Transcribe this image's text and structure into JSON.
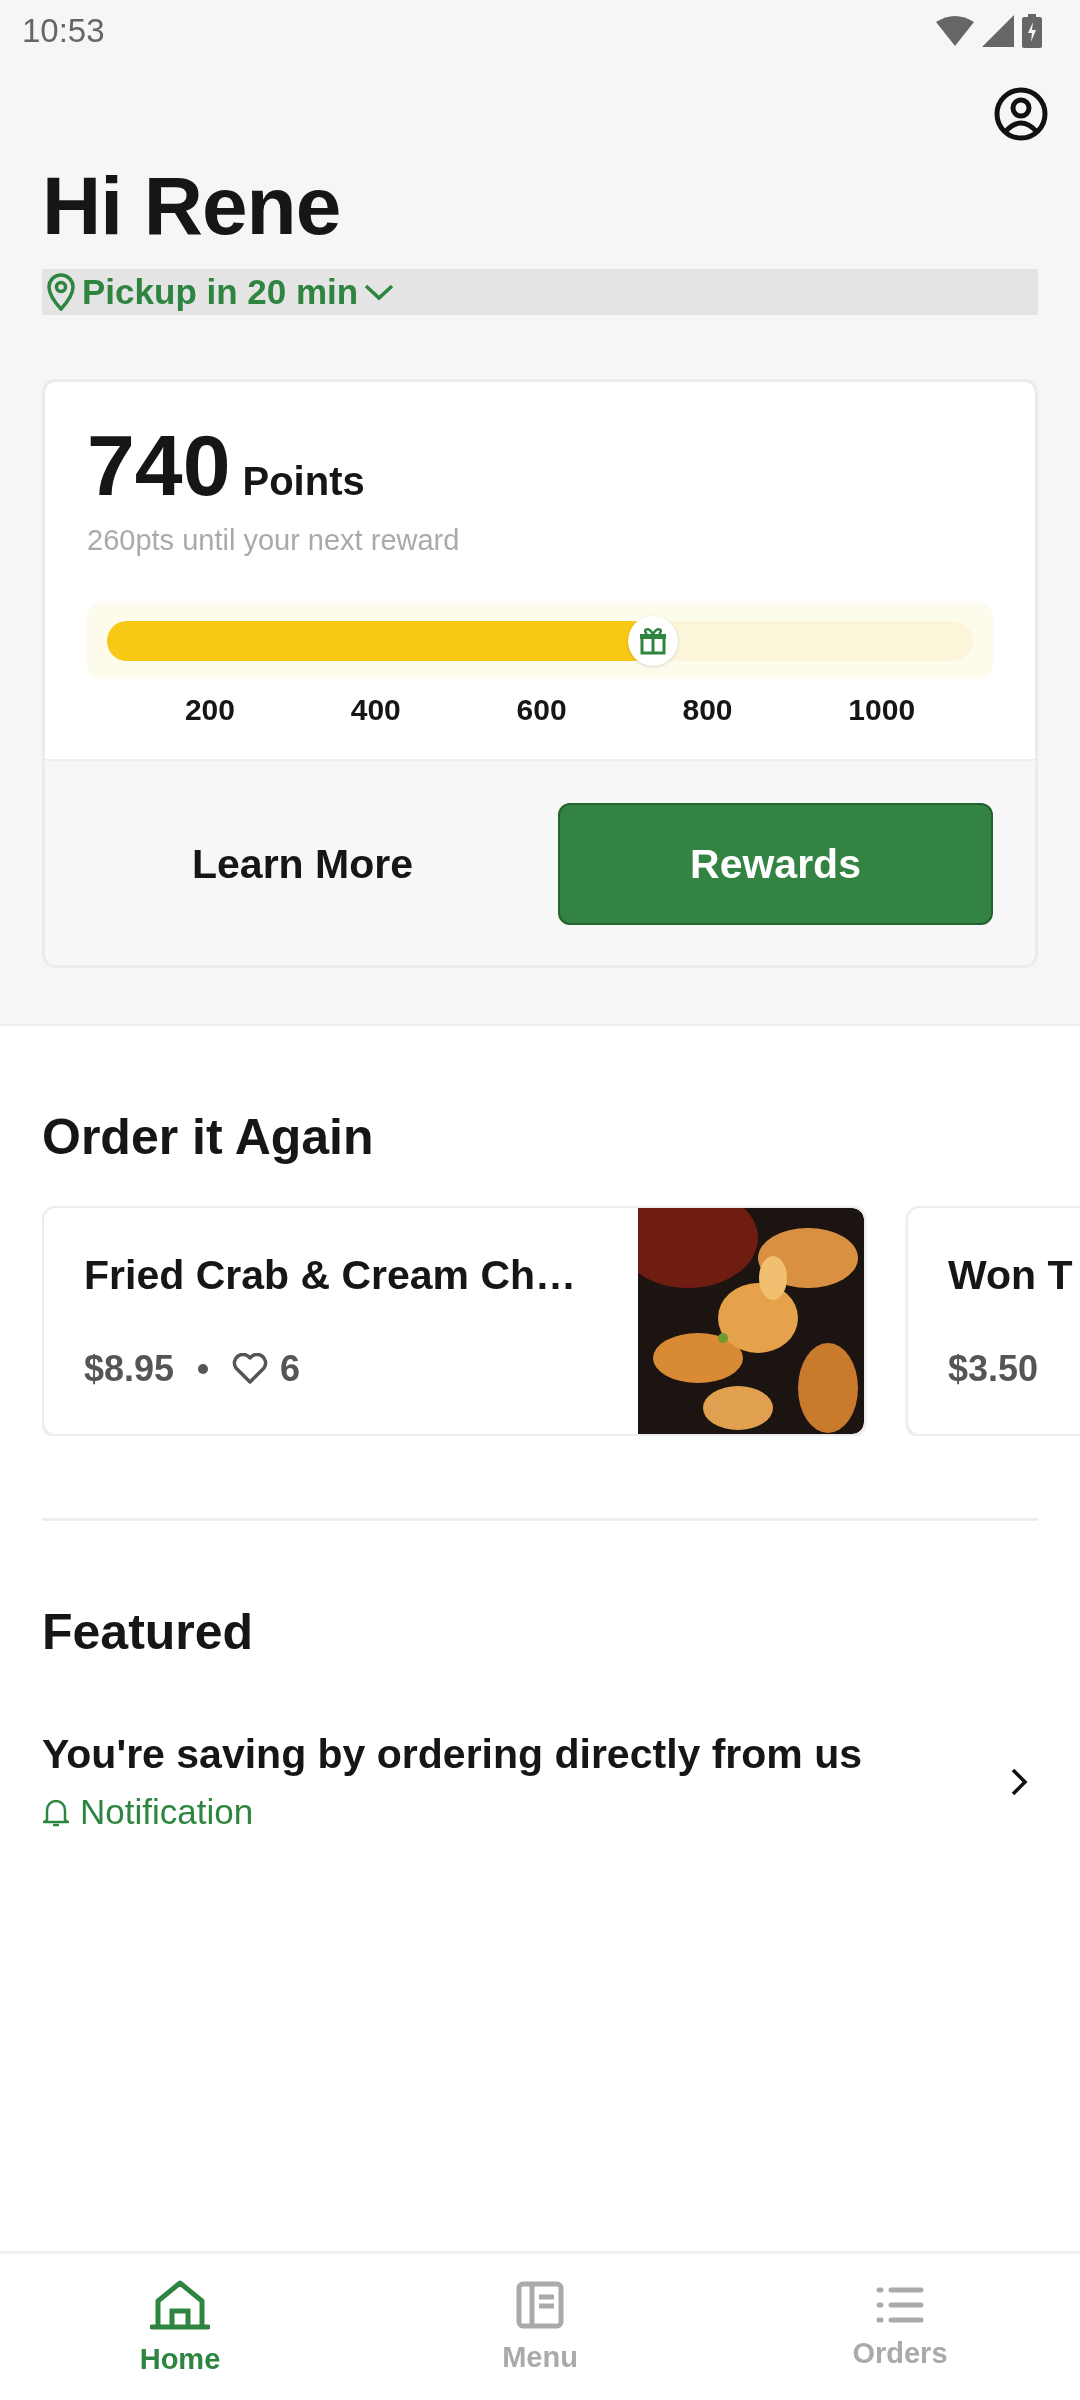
{
  "status_bar": {
    "time": "10:53"
  },
  "greeting": "Hi Rene",
  "pickup": {
    "label": "Pickup in 20 min"
  },
  "rewards_card": {
    "points": "740",
    "points_label": "Points",
    "subtitle": "260pts until your next reward",
    "progress": {
      "level": 0.63
    },
    "ticks": [
      "200",
      "400",
      "600",
      "800",
      "1000"
    ],
    "buttons": [
      {
        "label": "Learn More",
        "kind": "plain"
      },
      {
        "label": "Rewards",
        "kind": "primary"
      }
    ]
  },
  "order_again": {
    "title": "Order it Again",
    "items": [
      {
        "name": "Fried Crab & Cream Ch…",
        "price": "$8.95",
        "likes": "6"
      },
      {
        "name": "Won T",
        "price": "$3.50"
      }
    ]
  },
  "featured": {
    "title": "Featured",
    "items": [
      {
        "title": "You're saving by ordering directly from us",
        "tag": "Notification"
      }
    ]
  },
  "bottom_nav": [
    {
      "label": "Home",
      "selected": true
    },
    {
      "label": "Menu",
      "selected": false
    },
    {
      "label": "Orders",
      "selected": false
    }
  ]
}
